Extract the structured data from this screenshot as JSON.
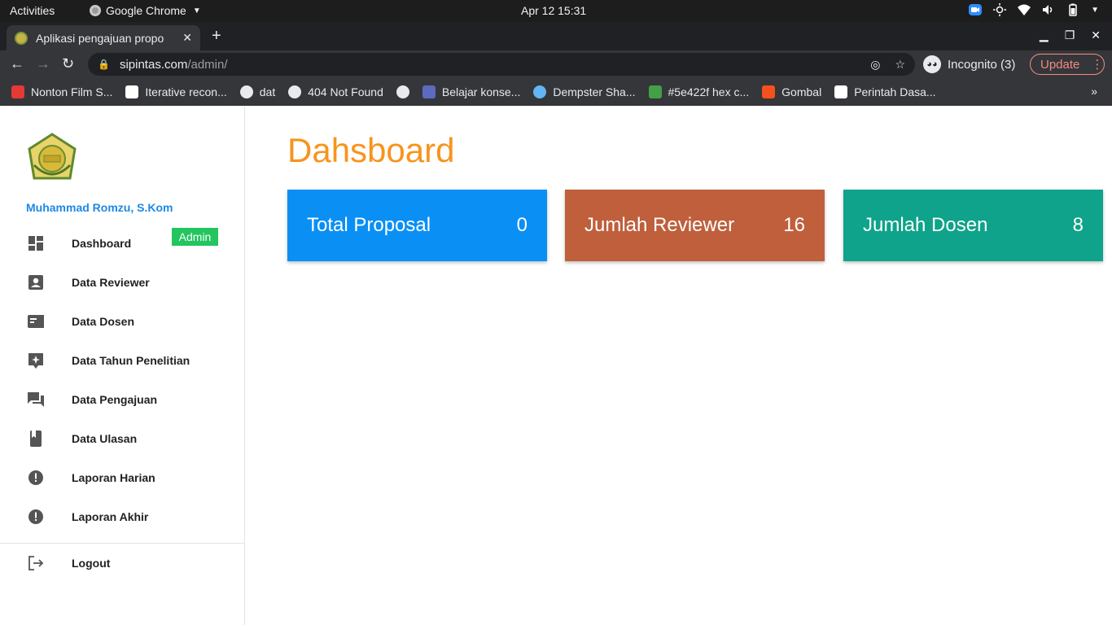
{
  "system": {
    "activities": "Activities",
    "app_name": "Google Chrome",
    "clock": "Apr 12  15:31"
  },
  "browser": {
    "tab_title": "Aplikasi pengajuan propo",
    "url_domain": "sipintas.com",
    "url_path": "/admin/",
    "incognito_label": "Incognito (3)",
    "update_label": "Update",
    "bookmarks": [
      {
        "label": "Nonton Film S...",
        "icon": "multicolor-icon",
        "color": "#e53935"
      },
      {
        "label": "Iterative recon...",
        "icon": "wikipedia-icon",
        "color": "#ffffff"
      },
      {
        "label": "dat",
        "icon": "globe-icon",
        "color": "#e8eaed"
      },
      {
        "label": "404 Not Found",
        "icon": "globe-icon",
        "color": "#e8eaed"
      },
      {
        "label": "",
        "icon": "globe-icon",
        "color": "#e8eaed"
      },
      {
        "label": "Belajar konse...",
        "icon": "x-icon",
        "color": "#5c6bc0"
      },
      {
        "label": "Dempster Sha...",
        "icon": "globe-icon",
        "color": "#64b5f6"
      },
      {
        "label": "#5e422f hex c...",
        "icon": "hex-icon",
        "color": "#43a047"
      },
      {
        "label": "Gombal",
        "icon": "blogger-icon",
        "color": "#f4511e"
      },
      {
        "label": "Perintah Dasa...",
        "icon": "medium-icon",
        "color": "#ffffff"
      }
    ]
  },
  "sidebar": {
    "user_name": "Muhammad Romzu, S.Kom",
    "role_badge": "Admin",
    "items": [
      {
        "label": "Dashboard",
        "icon": "dashboard-icon"
      },
      {
        "label": "Data Reviewer",
        "icon": "account-box-icon"
      },
      {
        "label": "Data Dosen",
        "icon": "card-icon"
      },
      {
        "label": "Data Tahun Penelitian",
        "icon": "sparkle-icon"
      },
      {
        "label": "Data Pengajuan",
        "icon": "forum-icon"
      },
      {
        "label": "Data Ulasan",
        "icon": "book-icon"
      },
      {
        "label": "Laporan Harian",
        "icon": "alert-icon"
      },
      {
        "label": "Laporan Akhir",
        "icon": "alert-icon"
      }
    ],
    "logout_label": "Logout"
  },
  "main": {
    "title": "Dahsboard",
    "cards": [
      {
        "label": "Total Proposal",
        "value": "0",
        "color": "#0a8ff5"
      },
      {
        "label": "Jumlah Reviewer",
        "value": "16",
        "color": "#bf5f3c"
      },
      {
        "label": "Jumlah Dosen",
        "value": "8",
        "color": "#0ea38a"
      }
    ]
  }
}
